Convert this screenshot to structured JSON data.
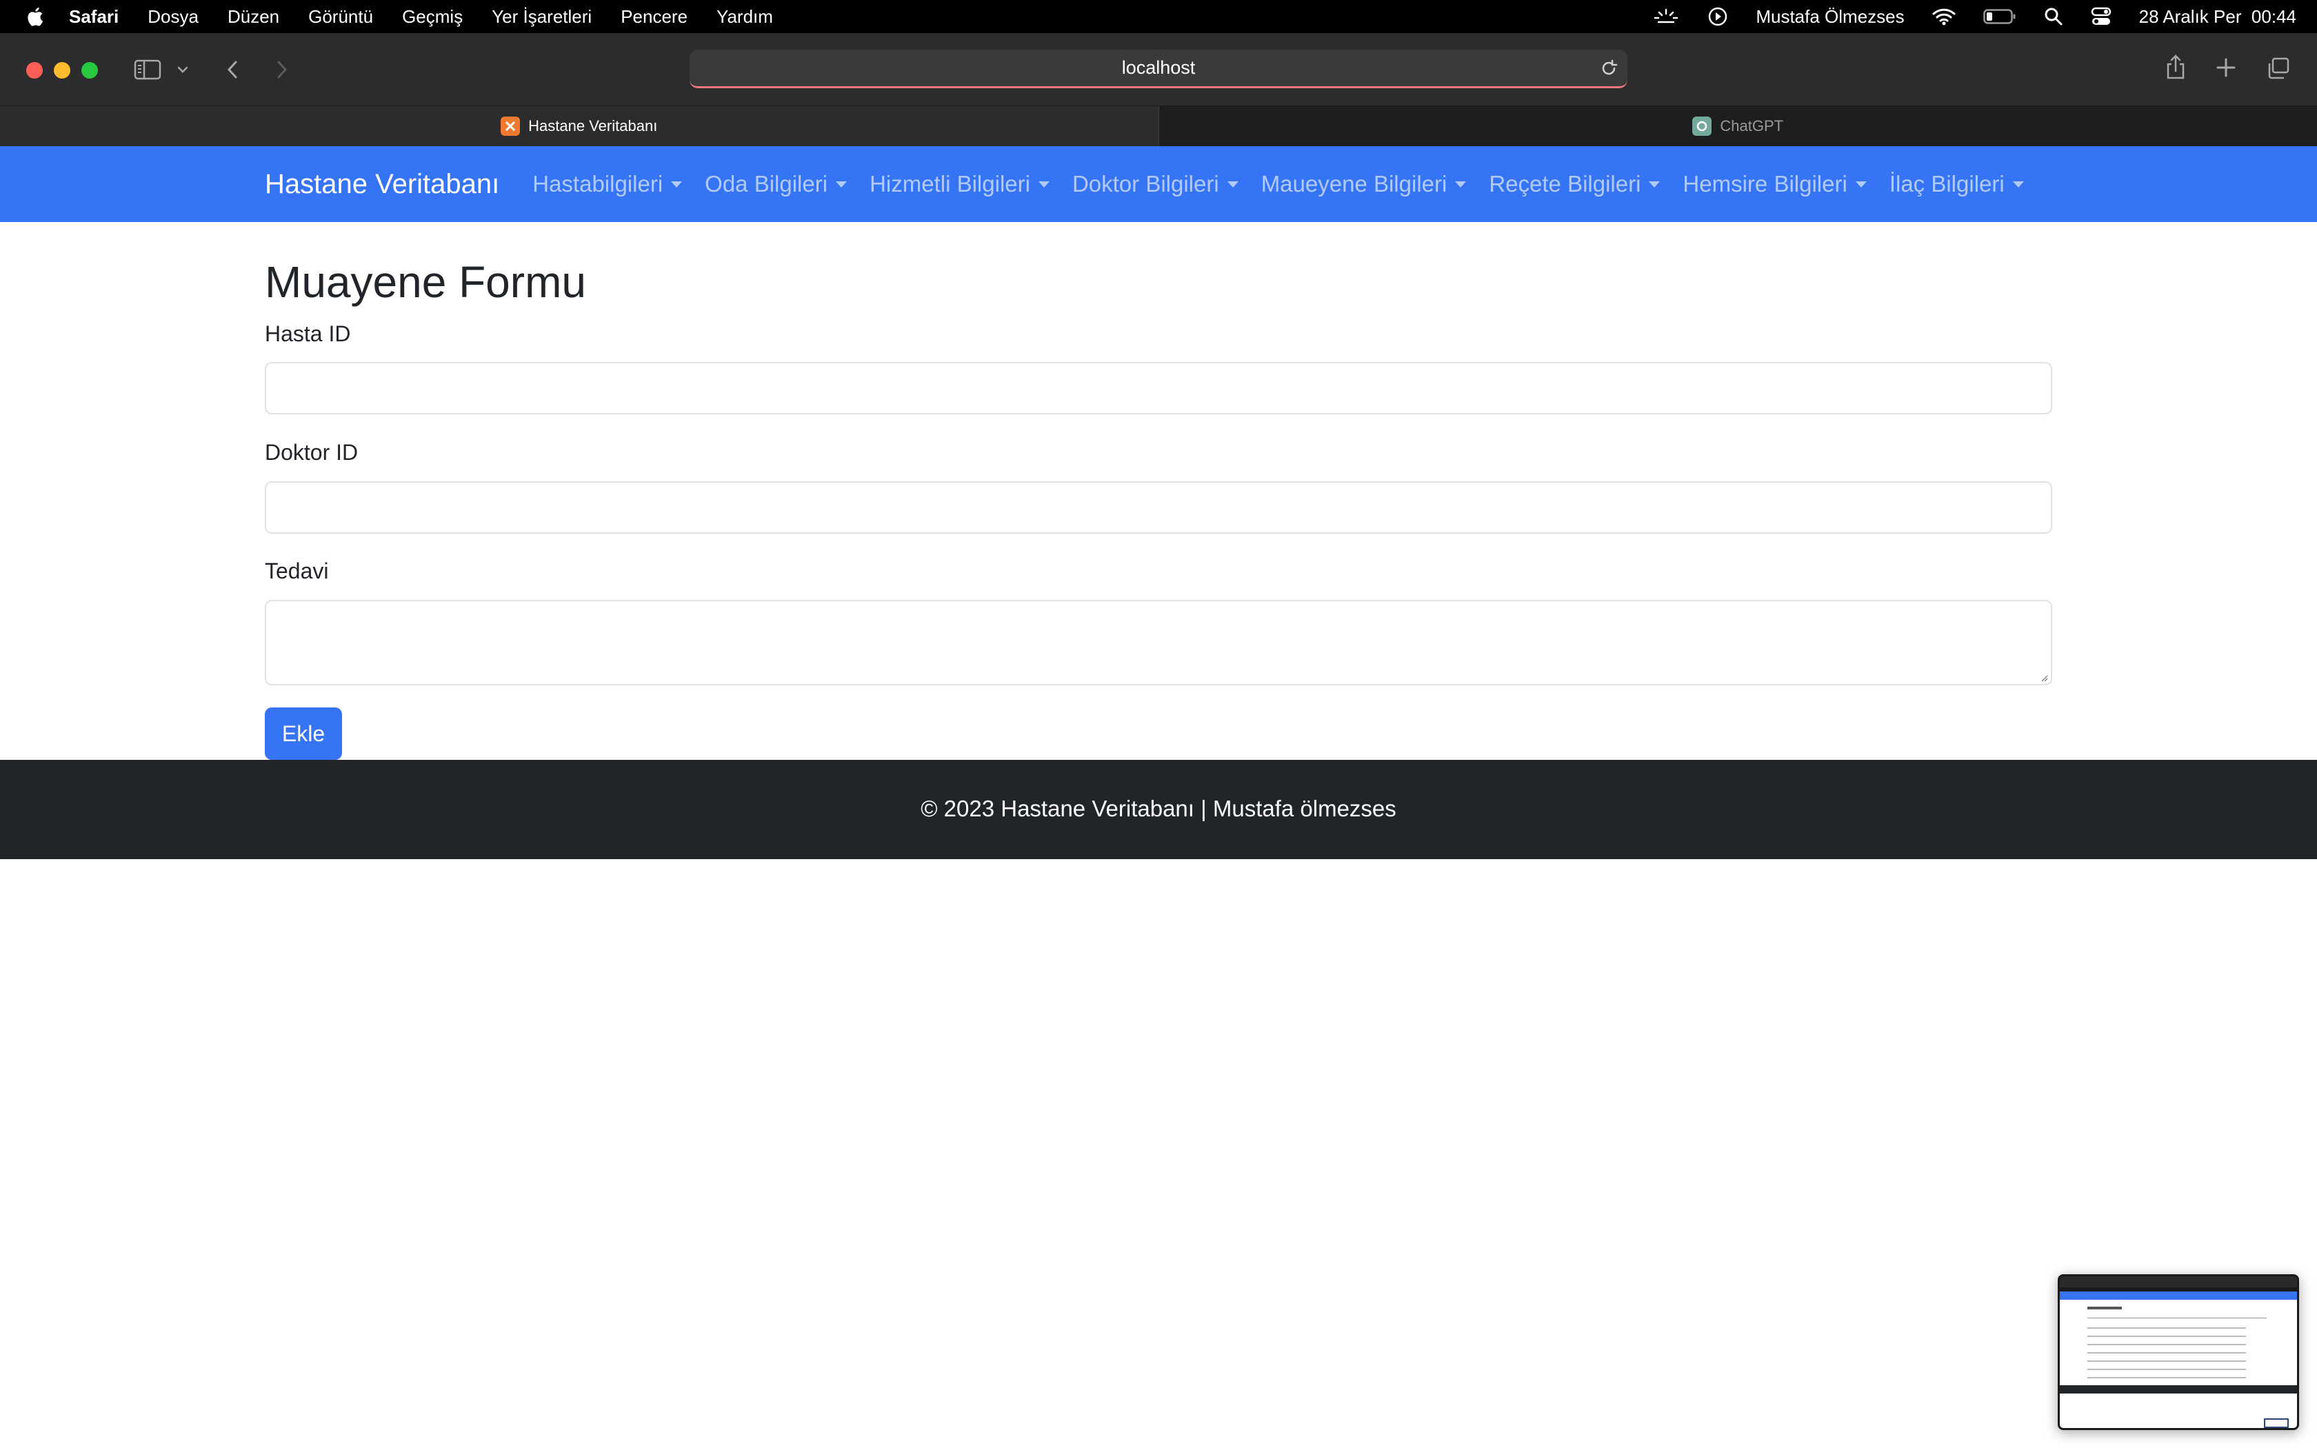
{
  "menubar": {
    "app": "Safari",
    "items": [
      "Dosya",
      "Düzen",
      "Görüntü",
      "Geçmiş",
      "Yer İşaretleri",
      "Pencere",
      "Yardım"
    ],
    "user": "Mustafa Ölmezses",
    "datetime": "28 Aralık Per  00:44",
    "icons": [
      "apple-icon",
      "brightness-icon",
      "play-icon",
      "wifi-icon",
      "battery-icon",
      "search-icon",
      "control-center-icon"
    ]
  },
  "browser": {
    "url": "localhost",
    "tabs": [
      {
        "title": "Hastane Veritabanı",
        "active": true,
        "favicon_color": "#f07a2f"
      },
      {
        "title": "ChatGPT",
        "active": false,
        "favicon_color": "#74aa9c"
      }
    ],
    "icons": [
      "sidebar-icon",
      "chevron-down-icon",
      "back-icon",
      "forward-icon",
      "reload-icon",
      "share-icon",
      "new-tab-icon",
      "tab-overview-icon"
    ]
  },
  "navbar": {
    "brand": "Hastane Veritabanı",
    "items": [
      "Hastabilgileri",
      "Oda Bilgileri",
      "Hizmetli Bilgileri",
      "Doktor Bilgileri",
      "Maueyene Bilgileri",
      "Reçete Bilgileri",
      "Hemsire Bilgileri",
      "İlaç Bilgileri"
    ],
    "color": "#3474f5"
  },
  "form": {
    "title": "Muayene Formu",
    "fields": [
      {
        "label": "Hasta ID",
        "value": ""
      },
      {
        "label": "Doktor ID",
        "value": ""
      },
      {
        "label": "Tedavi",
        "value": ""
      }
    ],
    "submit_label": "Ekle"
  },
  "footer": {
    "text": "© 2023 Hastane Veritabanı | Mustafa ölmezses",
    "color": "#212529"
  }
}
